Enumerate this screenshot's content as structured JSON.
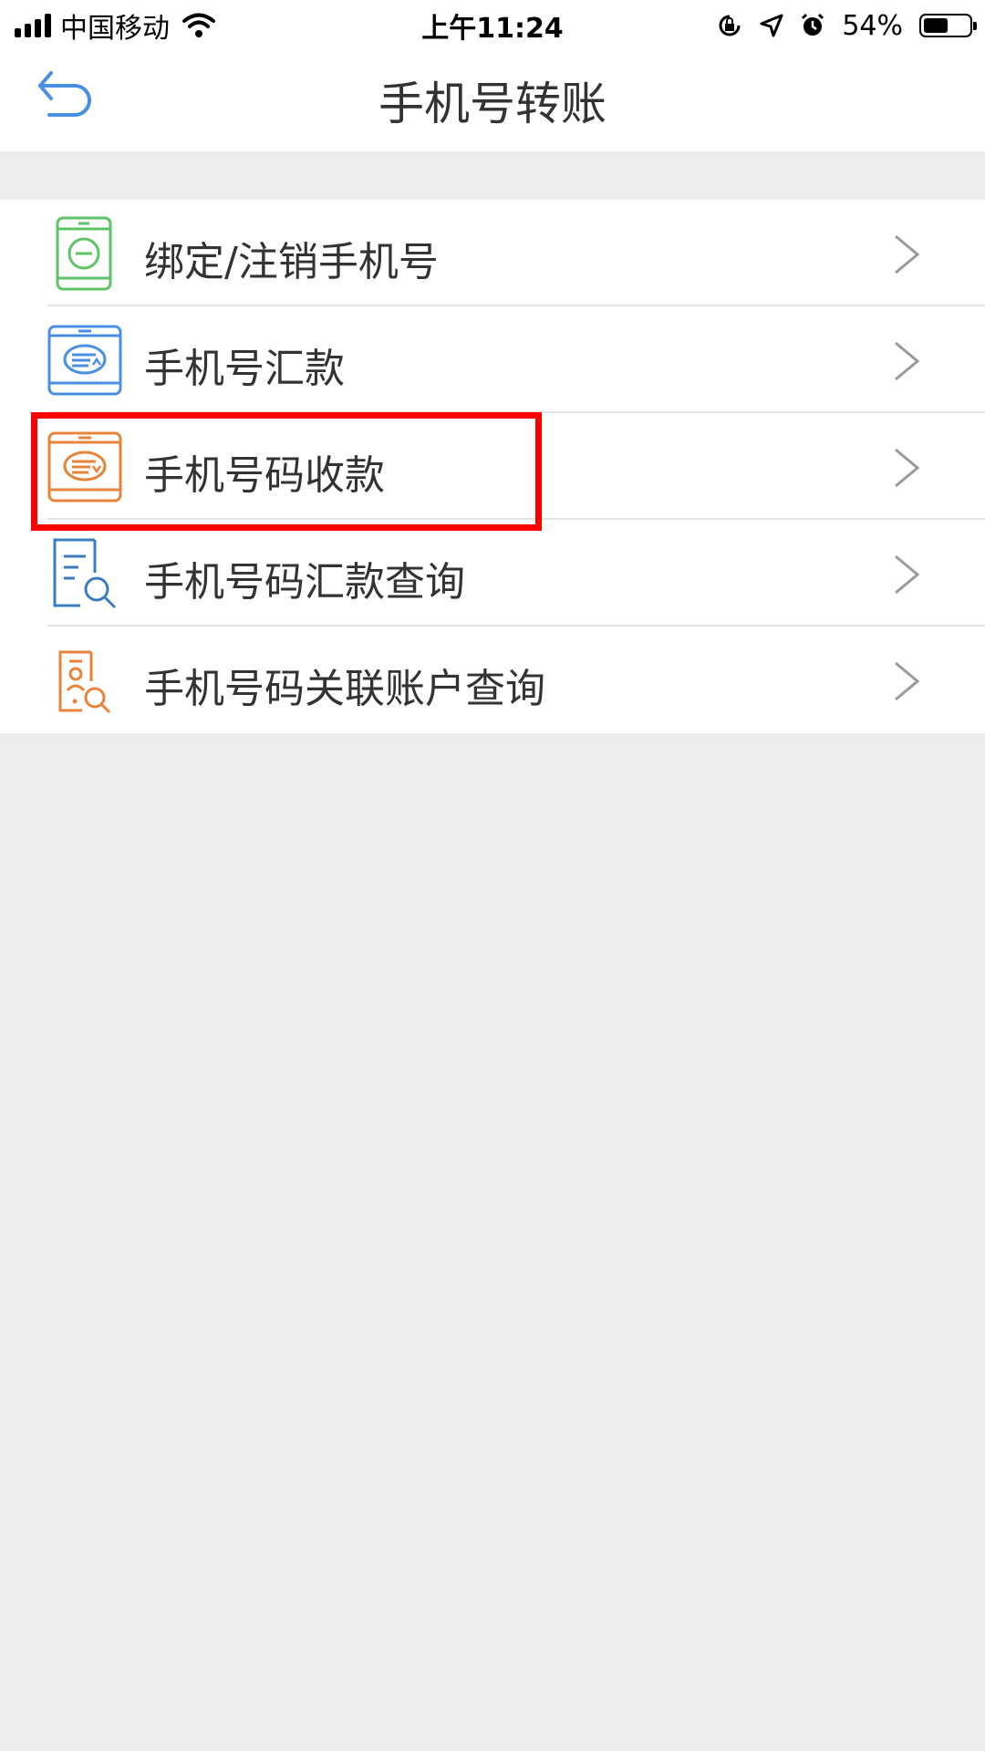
{
  "status_bar": {
    "carrier": "中国移动",
    "time": "上午11:24",
    "battery": "54%",
    "battery_level": 0.54
  },
  "nav": {
    "title": "手机号转账",
    "back_icon": "back-arrow-icon"
  },
  "menu": [
    {
      "label": "绑定/注销手机号",
      "icon": "phone-bind-icon",
      "color": "#5cc464"
    },
    {
      "label": "手机号汇款",
      "icon": "phone-remit-icon",
      "color": "#4a90e2"
    },
    {
      "label": "手机号码收款",
      "icon": "phone-receive-icon",
      "color": "#e8843a"
    },
    {
      "label": "手机号码汇款查询",
      "icon": "remit-query-icon",
      "color": "#3c7cc0"
    },
    {
      "label": "手机号码关联账户查询",
      "icon": "account-query-icon",
      "color": "#e8843a"
    }
  ],
  "colors": {
    "highlight": "#ff0000",
    "background": "#ededed"
  }
}
